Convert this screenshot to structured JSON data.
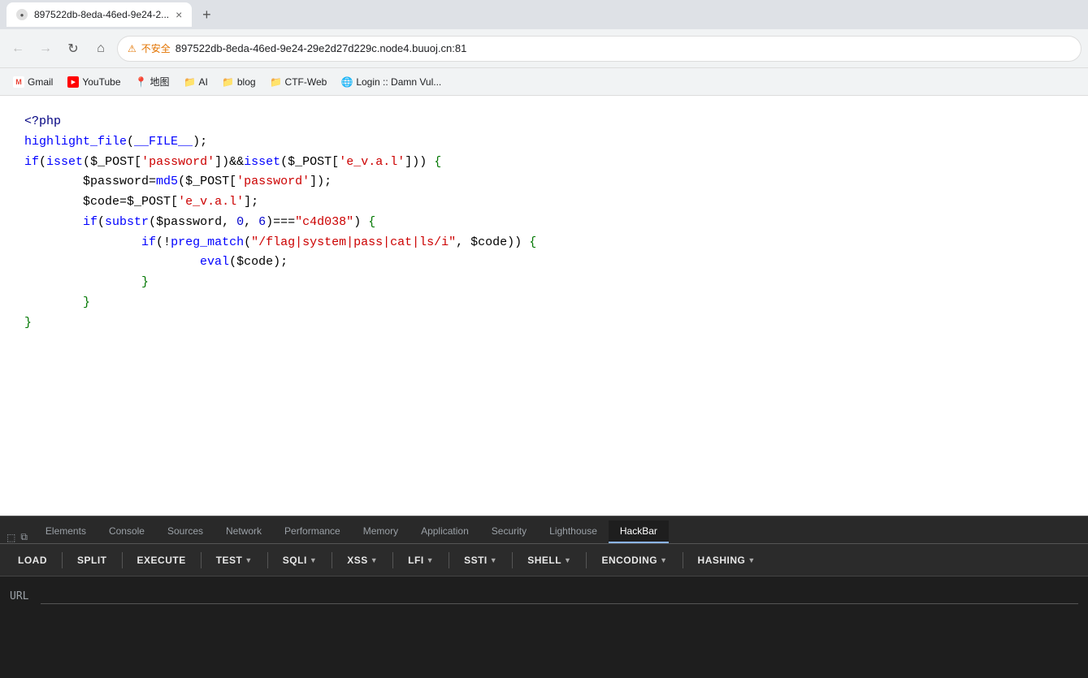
{
  "browser": {
    "tab_title": "897522db-8eda-46ed-9e24-2...",
    "tab_full_title": "897522db-8eda-46ed-9e24-29e2d27d229c.node4.buuoj.cn:81",
    "new_tab_label": "+",
    "back_label": "←",
    "forward_label": "→",
    "reload_label": "↻",
    "home_label": "⌂",
    "security_label": "不安全",
    "address_url": "897522db-8eda-46ed-9e24-29e2d27d229c.node4.buuoj.cn:81"
  },
  "bookmarks": [
    {
      "id": "gmail",
      "icon": "M",
      "label": "Gmail",
      "icon_type": "gmail"
    },
    {
      "id": "youtube",
      "icon": "▶",
      "label": "YouTube",
      "icon_type": "youtube"
    },
    {
      "id": "maps",
      "icon": "📍",
      "label": "地图",
      "icon_type": "maps"
    },
    {
      "id": "ai",
      "icon": "📁",
      "label": "AI",
      "icon_type": "folder"
    },
    {
      "id": "blog",
      "icon": "📁",
      "label": "blog",
      "icon_type": "folder"
    },
    {
      "id": "ctf-web",
      "icon": "📁",
      "label": "CTF-Web",
      "icon_type": "folder"
    },
    {
      "id": "login",
      "icon": "🌐",
      "label": "Login :: Damn Vul...",
      "icon_type": "globe"
    }
  ],
  "code": {
    "line1": "<?php",
    "line2": "highlight_file(__FILE__);",
    "line3": "if(isset($_POST['password'])&&isset($_POST['e_v.a.l'])) {",
    "line4": "        $password=md5($_POST['password']);",
    "line5": "        $code=$_POST['e_v.a.l'];",
    "line6": "        if(substr($password, 0, 6)===\"c4d038\") {",
    "line7": "                if(!preg_match(\"/flag|system|pass|cat|ls/i\", $code)) {",
    "line8": "                        eval($code);",
    "line9": "                }",
    "line10": "        }",
    "line11": "}"
  },
  "devtools": {
    "tabs": [
      {
        "id": "elements",
        "label": "Elements"
      },
      {
        "id": "console",
        "label": "Console"
      },
      {
        "id": "sources",
        "label": "Sources"
      },
      {
        "id": "network",
        "label": "Network"
      },
      {
        "id": "performance",
        "label": "Performance"
      },
      {
        "id": "memory",
        "label": "Memory"
      },
      {
        "id": "application",
        "label": "Application"
      },
      {
        "id": "security",
        "label": "Security"
      },
      {
        "id": "lighthouse",
        "label": "Lighthouse"
      },
      {
        "id": "hackbar",
        "label": "HackBar",
        "active": true
      }
    ],
    "hackbar": {
      "buttons": [
        {
          "id": "load",
          "label": "LOAD",
          "has_dropdown": false
        },
        {
          "id": "split",
          "label": "SPLIT",
          "has_dropdown": false
        },
        {
          "id": "execute",
          "label": "EXECUTE",
          "has_dropdown": false
        },
        {
          "id": "test",
          "label": "TEST",
          "has_dropdown": true
        },
        {
          "id": "sqli",
          "label": "SQLI",
          "has_dropdown": true
        },
        {
          "id": "xss",
          "label": "XSS",
          "has_dropdown": true
        },
        {
          "id": "lfi",
          "label": "LFI",
          "has_dropdown": true
        },
        {
          "id": "ssti",
          "label": "SSTI",
          "has_dropdown": true
        },
        {
          "id": "shell",
          "label": "SHELL",
          "has_dropdown": true
        },
        {
          "id": "encoding",
          "label": "ENCODING",
          "has_dropdown": true
        },
        {
          "id": "hashing",
          "label": "HASHING",
          "has_dropdown": true
        }
      ],
      "url_label": "URL",
      "url_placeholder": ""
    }
  }
}
